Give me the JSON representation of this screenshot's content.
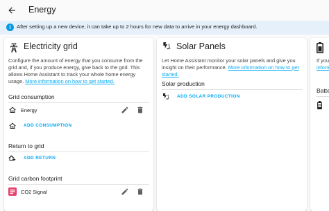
{
  "header": {
    "title": "Energy"
  },
  "banner": {
    "text": "After setting up a new device, it can take up to 2 hours for new data to arrive in your energy dashboard."
  },
  "grid_card": {
    "title": "Electricity grid",
    "desc_prefix": "Configure the amount of energy that you consume from the grid and, if you produce energy, give back to the grid. This allows Home Assistant to track your whole home energy usage. ",
    "desc_link": "More information on how to get started.",
    "consumption": {
      "heading": "Grid consumption",
      "item": "Energy",
      "add_label": "ADD CONSUMPTION"
    },
    "return": {
      "heading": "Return to grid",
      "add_label": "ADD RETURN"
    },
    "carbon": {
      "heading": "Grid carbon footprint",
      "item": "CO2 Signal"
    }
  },
  "solar_card": {
    "title": "Solar Panels",
    "desc_prefix": "Let Home Assistant monitor your solar panels and give you insight on their performance. ",
    "desc_link": "More information on how to get started.",
    "production": {
      "heading": "Solar production",
      "add_label": "ADD SOLAR PRODUCTION"
    }
  },
  "battery_card": {
    "desc_partial": "If you",
    "desc_link_partial": "inform",
    "heading_partial": "Batte"
  },
  "colors": {
    "accent": "#03a9f4",
    "info": "#039be5",
    "banner_bg": "#e6f0fa",
    "co2": "#e5426b"
  },
  "icons": [
    "arrow-left-icon",
    "info-icon",
    "transmission-tower-icon",
    "solar-power-icon",
    "home-import-icon",
    "home-export-icon",
    "pencil-icon",
    "delete-icon",
    "battery-icon",
    "co2-signal-icon"
  ]
}
